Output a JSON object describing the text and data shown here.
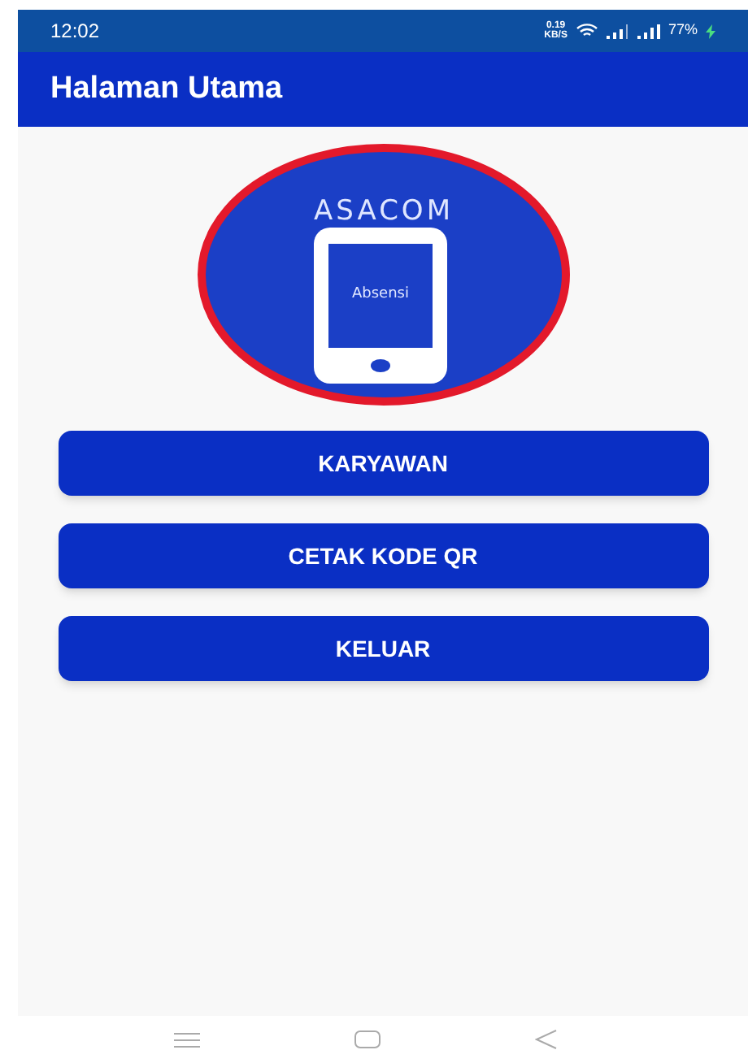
{
  "status_bar": {
    "time": "12:02",
    "speed": "0.19",
    "speed_unit": "KB/S",
    "battery": "77%"
  },
  "app_bar": {
    "title": "Halaman Utama"
  },
  "logo": {
    "title": "ASACOM",
    "screen_text": "Absensi"
  },
  "buttons": [
    {
      "label": "KARYAWAN"
    },
    {
      "label": "CETAK KODE QR"
    },
    {
      "label": "KELUAR"
    }
  ]
}
